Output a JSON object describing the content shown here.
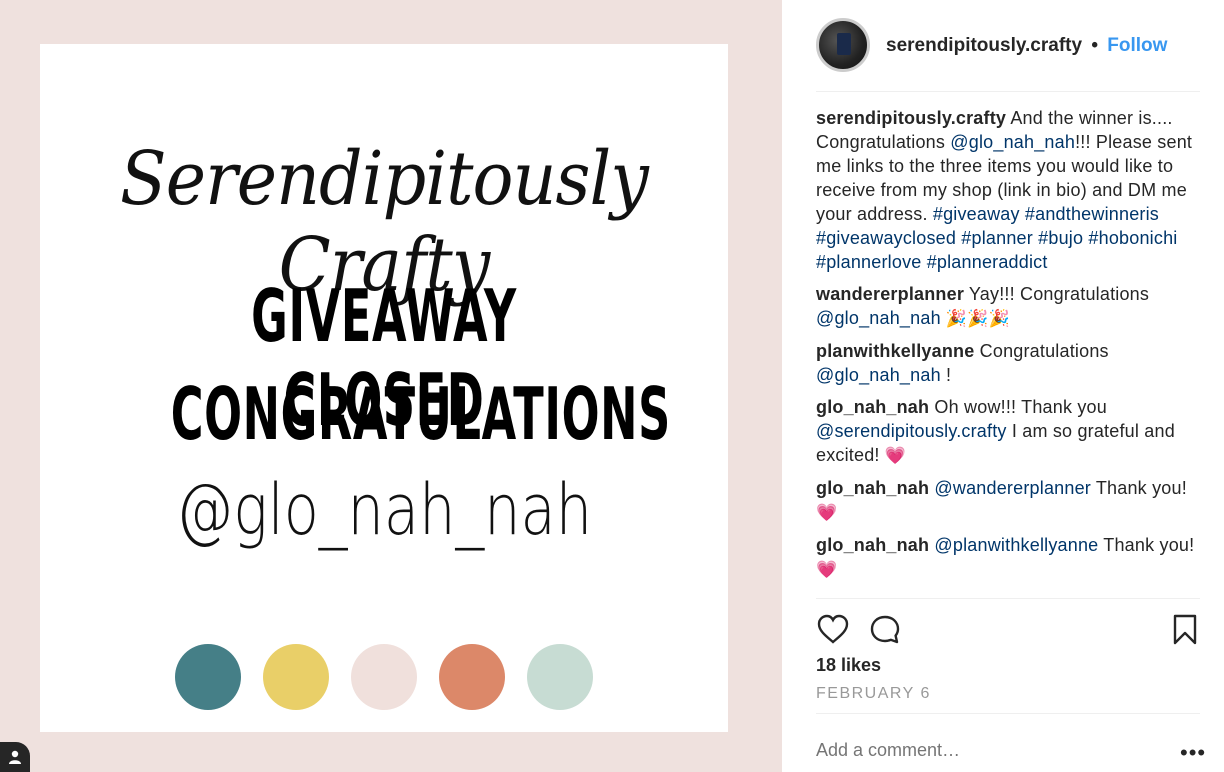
{
  "post_image": {
    "script_title": "Serendipitously Crafty",
    "line1": "GIVEAWAY CLOSED",
    "line2": "CONGRATULATIONS",
    "handle": "@glo_nah_nah",
    "swatches": [
      "#457f87",
      "#e9cf68",
      "#f0e0dc",
      "#dc8869",
      "#c7dcd3"
    ]
  },
  "header": {
    "username": "serendipitously.crafty",
    "separator": "•",
    "follow_label": "Follow"
  },
  "comments": [
    {
      "user": "serendipitously.crafty",
      "parts": [
        {
          "t": " And the winner is.... Congratulations "
        },
        {
          "t": "@glo_nah_nah",
          "link": true
        },
        {
          "t": "!!! Please sent me links to the three items you would like to receive from my shop (link in bio) and DM me your address. "
        },
        {
          "t": "#giveaway",
          "link": true
        },
        {
          "t": " "
        },
        {
          "t": "#andthewinneris",
          "link": true
        },
        {
          "t": " "
        },
        {
          "t": "#giveawayclosed",
          "link": true
        },
        {
          "t": " "
        },
        {
          "t": "#planner",
          "link": true
        },
        {
          "t": " "
        },
        {
          "t": "#bujo",
          "link": true
        },
        {
          "t": " "
        },
        {
          "t": "#hobonichi",
          "link": true
        },
        {
          "t": " "
        },
        {
          "t": "#plannerlove",
          "link": true
        },
        {
          "t": " "
        },
        {
          "t": "#planneraddict",
          "link": true
        }
      ]
    },
    {
      "user": "wandererplanner",
      "parts": [
        {
          "t": " Yay!!! Congratulations "
        },
        {
          "t": "@glo_nah_nah",
          "link": true
        },
        {
          "t": " 🎉🎉🎉",
          "emoji": true
        }
      ]
    },
    {
      "user": "planwithkellyanne",
      "parts": [
        {
          "t": " Congratulations "
        },
        {
          "t": "@glo_nah_nah",
          "link": true
        },
        {
          "t": " !"
        }
      ]
    },
    {
      "user": "glo_nah_nah",
      "parts": [
        {
          "t": " Oh wow!!! Thank you "
        },
        {
          "t": "@serendipitously.crafty",
          "link": true
        },
        {
          "t": " I am so grateful and excited! "
        },
        {
          "t": "💗",
          "emoji": true
        }
      ]
    },
    {
      "user": "glo_nah_nah",
      "parts": [
        {
          "t": " "
        },
        {
          "t": "@wandererplanner",
          "link": true
        },
        {
          "t": " Thank you! "
        },
        {
          "t": "💗",
          "emoji": true
        }
      ]
    },
    {
      "user": "glo_nah_nah",
      "parts": [
        {
          "t": " "
        },
        {
          "t": "@planwithkellyanne",
          "link": true
        },
        {
          "t": " Thank you! "
        },
        {
          "t": "💗",
          "emoji": true
        }
      ]
    }
  ],
  "actions": {
    "icons": [
      "heart-icon",
      "comment-icon",
      "bookmark-icon"
    ],
    "likes": "18 likes",
    "date": "FEBRUARY 6"
  },
  "comment_box": {
    "placeholder": "Add a comment…",
    "more_label": "•••"
  }
}
